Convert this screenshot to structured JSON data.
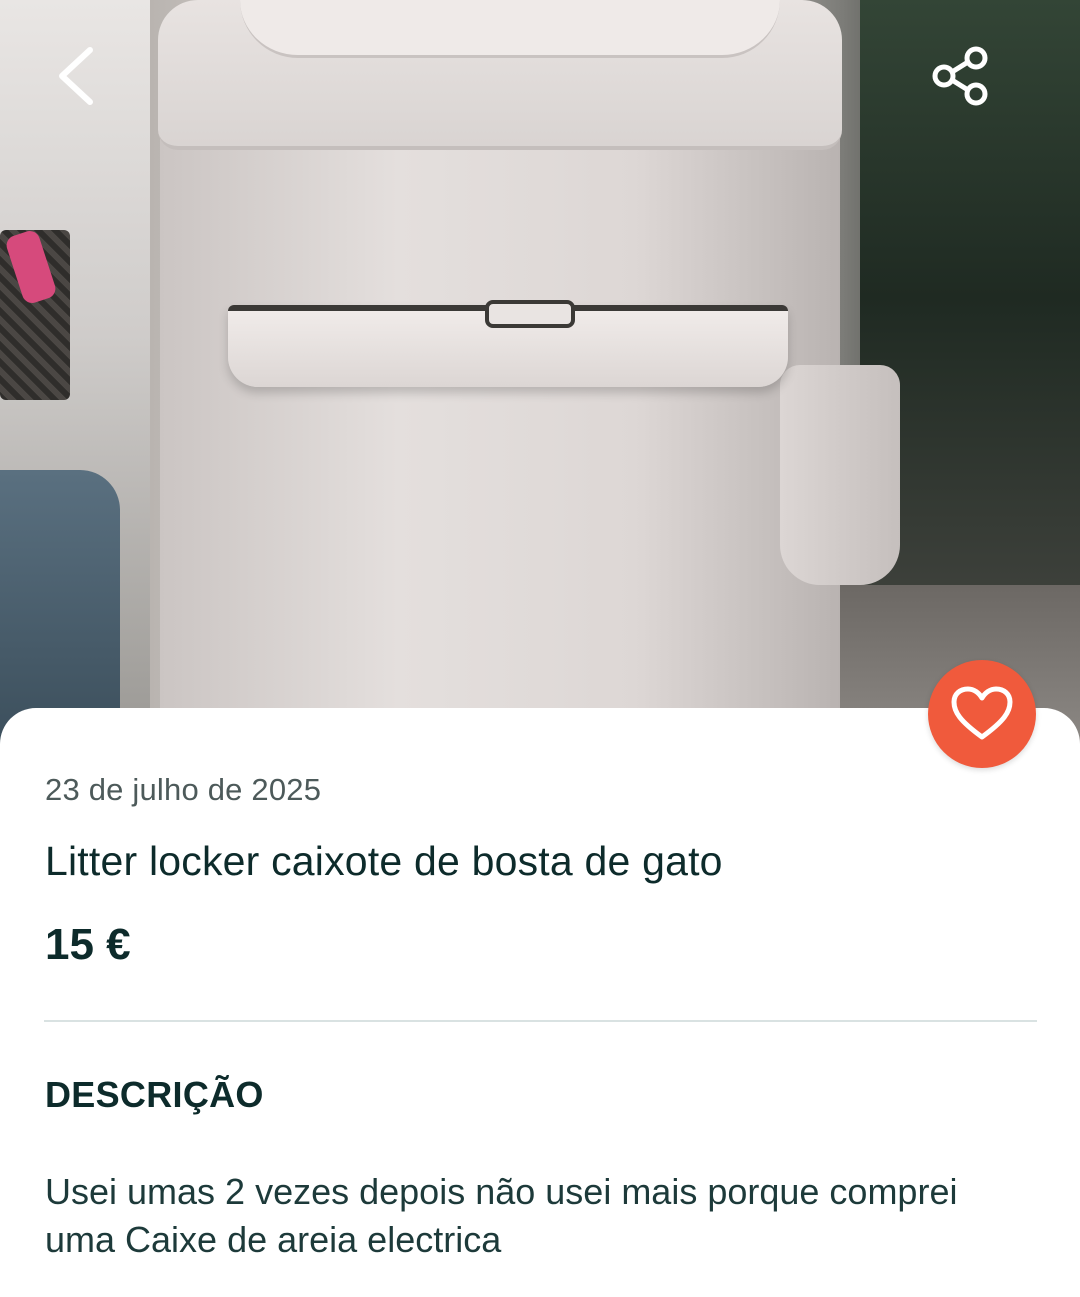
{
  "header": {
    "back_icon": "chevron-left-icon",
    "share_icon": "share-icon"
  },
  "photo": {
    "subject": "listing-photo"
  },
  "favorite": {
    "icon": "heart-icon",
    "color": "#f05a3c"
  },
  "listing": {
    "date": "23 de julho de 2025",
    "title": "Litter locker caixote de bosta de gato",
    "price": "15 €"
  },
  "description": {
    "heading": "DESCRIÇÃO",
    "text_line1": "Usei umas 2 vezes depois não usei mais porque comprei",
    "text_line2": "uma Caixe de areia electrica"
  },
  "colors": {
    "accent": "#f05a3c",
    "text_primary": "#0d2b2b",
    "text_secondary": "#4d5a5a",
    "divider": "#d9e2e2"
  }
}
